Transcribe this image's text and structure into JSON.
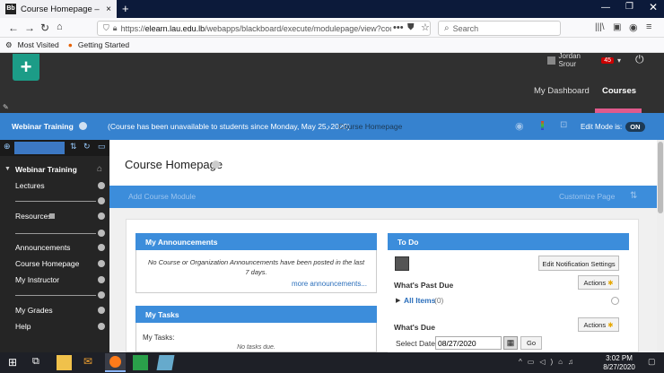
{
  "browser": {
    "tab_title": "Course Homepage – Webinar",
    "tab_icon_text": "Bb",
    "url_prefix": "https://",
    "url_host": "elearn.lau.edu.lb",
    "url_path": "/webapps/blackboard/execute/modulepage/view?course",
    "search_placeholder": "Search",
    "bookmarks": [
      "Most Visited",
      "Getting Started"
    ]
  },
  "header": {
    "user_name": "Jordan Srour",
    "notification_count": "45",
    "nav": [
      "My Dashboard",
      "Courses"
    ]
  },
  "breadcrumb": {
    "course": "Webinar Training",
    "status": "(Course has been unavailable to students since Monday, May 25, 2020)",
    "current": "Course Homepage",
    "edit_mode_label": "Edit Mode is:",
    "edit_mode_value": "ON"
  },
  "sidebar": {
    "course_title": "Webinar Training",
    "items": [
      "Lectures",
      "Resources",
      "Announcements",
      "Course Homepage",
      "My Instructor",
      "My Grades",
      "Help"
    ]
  },
  "main": {
    "page_title": "Course Homepage",
    "add_module": "Add Course Module",
    "customize": "Customize Page"
  },
  "announcements": {
    "title": "My Announcements",
    "body": "No Course or Organization Announcements have been posted in the last 7 days.",
    "more": "more announcements..."
  },
  "tasks": {
    "title": "My Tasks",
    "label": "My Tasks:",
    "empty": "No tasks due."
  },
  "todo": {
    "title": "To Do",
    "edit_notifications": "Edit Notification Settings",
    "actions": "Actions",
    "past_due": "What's Past Due",
    "all_items": "All Items",
    "all_items_count": "(0)",
    "whats_due": "What's Due",
    "select_date_label": "Select Date:",
    "date_value": "08/27/2020",
    "go": "Go"
  },
  "taskbar": {
    "time": "3:02 PM",
    "date": "8/27/2020"
  },
  "colors": {
    "accent": "#3c8ddb",
    "header": "#303030",
    "sidebar": "#252525",
    "logo": "#1c9c87"
  }
}
